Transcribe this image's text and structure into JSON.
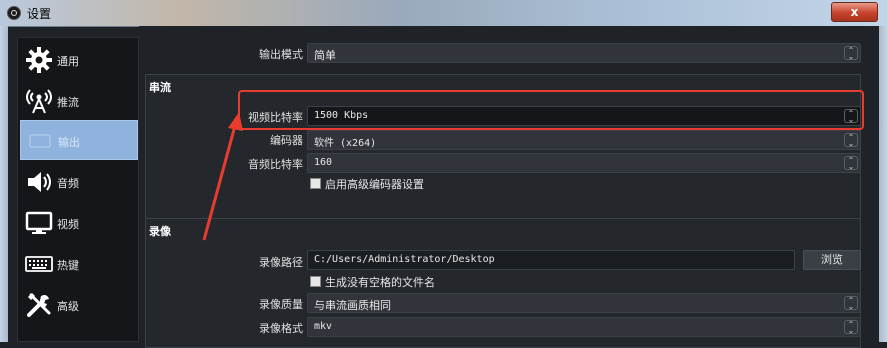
{
  "window": {
    "title": "设置",
    "close_symbol": "x"
  },
  "sidebar": {
    "items": [
      {
        "label": "通用",
        "icon": "gear-icon"
      },
      {
        "label": "推流",
        "icon": "broadcast-icon"
      },
      {
        "label": "输出",
        "icon": "output-icon",
        "active": true
      },
      {
        "label": "音频",
        "icon": "speaker-icon"
      },
      {
        "label": "视频",
        "icon": "monitor-icon"
      },
      {
        "label": "热键",
        "icon": "keyboard-icon"
      },
      {
        "label": "高级",
        "icon": "tools-icon"
      }
    ]
  },
  "output": {
    "mode_label": "输出模式",
    "mode_value": "简单",
    "streaming": {
      "title": "串流",
      "video_bitrate_label": "视频比特率",
      "video_bitrate_value": "1500 Kbps",
      "encoder_label": "编码器",
      "encoder_value": "软件 (x264)",
      "audio_bitrate_label": "音频比特率",
      "audio_bitrate_value": "160",
      "advanced_encoder_checkbox": "启用高级编码器设置"
    },
    "recording": {
      "title": "录像",
      "path_label": "录像路径",
      "path_value": "C:/Users/Administrator/Desktop",
      "browse_button": "浏览",
      "no_space_checkbox": "生成没有空格的文件名",
      "quality_label": "录像质量",
      "quality_value": "与串流画质相同",
      "format_label": "录像格式",
      "format_value": "mkv"
    }
  },
  "colors": {
    "highlight": "#e83c2e",
    "sidebar_active": "#8fb3dd"
  }
}
